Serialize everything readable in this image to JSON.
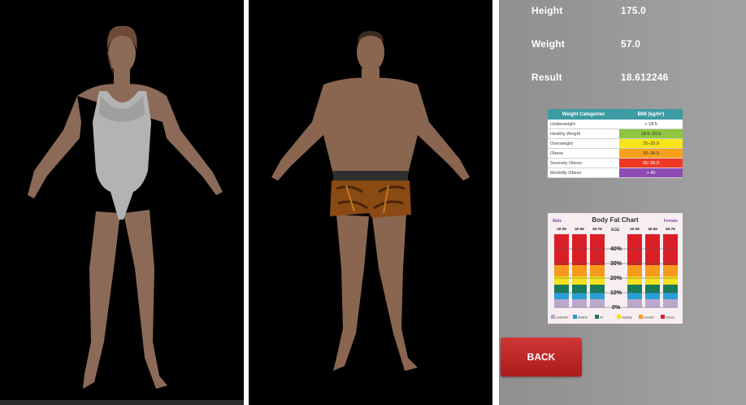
{
  "result": {
    "height_label": "Height",
    "height_value": "175.0",
    "weight_label": "Weight",
    "weight_value": "57.0",
    "result_label": "Result",
    "result_value": "18.612246"
  },
  "bmi_table": {
    "headers": [
      "Weight Categories",
      "BMI (kg/m²)"
    ],
    "rows": [
      {
        "category": "Underweight",
        "range": "< 18.5",
        "color": "#ffffff"
      },
      {
        "category": "Healthy Weight",
        "range": "18.5–24.9",
        "color": "#8ec63f"
      },
      {
        "category": "Overweight",
        "range": "25–29.9",
        "color": "#f7e51a"
      },
      {
        "category": "Obese",
        "range": "30–34.9",
        "color": "#f7a21a"
      },
      {
        "category": "Severely Obese",
        "range": "35–39.9",
        "color": "#ee3a24"
      },
      {
        "category": "Morbidly Obese",
        "range": "> 40",
        "color": "#8e4bb5"
      }
    ]
  },
  "body_fat_chart": {
    "title": "Body Fat Chart",
    "male_label": "Male",
    "female_label": "Female",
    "age_label": "AGE",
    "male_ages": [
      "20-39",
      "40-59",
      "60-79"
    ],
    "female_ages": [
      "20-39",
      "40-59",
      "60-79"
    ],
    "percent_ticks": [
      "40%",
      "30%",
      "20%",
      "10%",
      "0%"
    ],
    "legend": [
      {
        "label": "Underfat",
        "color": "#b9a8cc"
      },
      {
        "label": "Athletic",
        "color": "#2a9fd6"
      },
      {
        "label": "Fit",
        "color": "#1a7a5a"
      },
      {
        "label": "Healthy",
        "color": "#f6e21c"
      },
      {
        "label": "Overfat",
        "color": "#f59a1b"
      },
      {
        "label": "Obese",
        "color": "#d91f26"
      }
    ]
  },
  "back_button": {
    "label": "BACK"
  }
}
